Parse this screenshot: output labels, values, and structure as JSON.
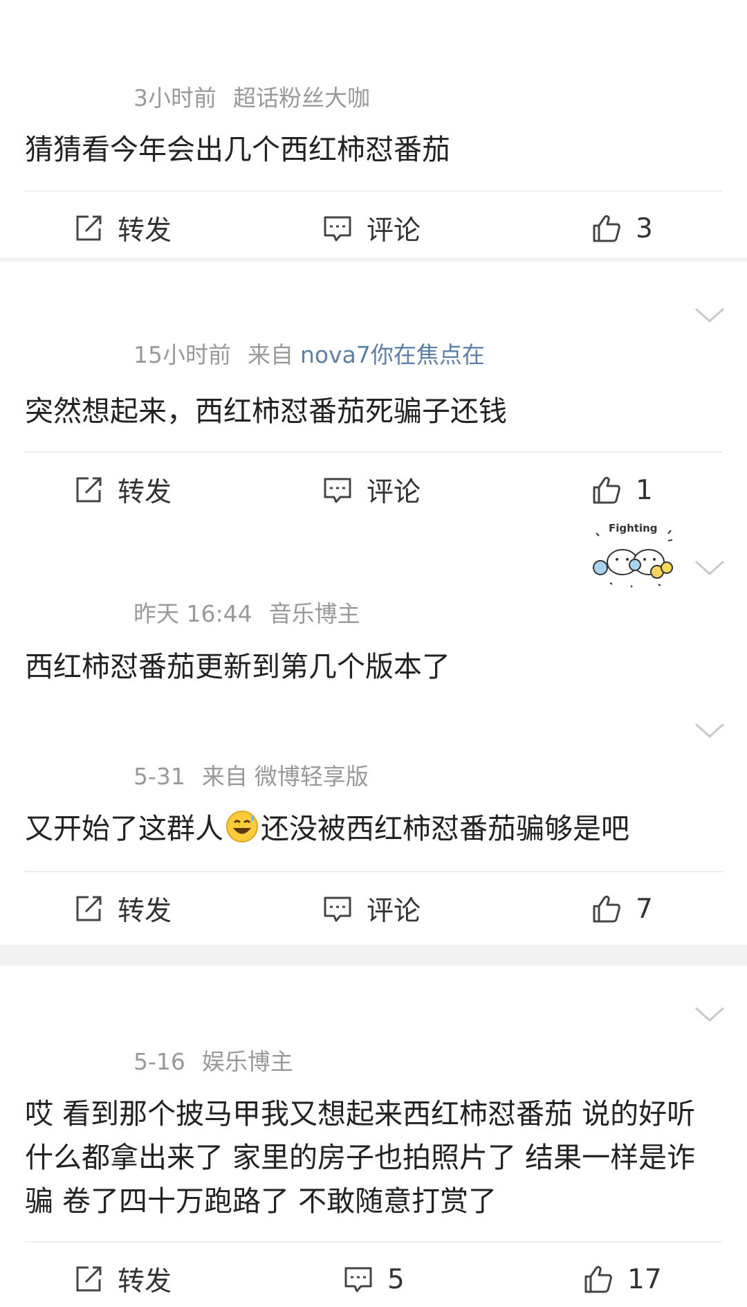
{
  "labels": {
    "repost": "转发",
    "comment": "评论"
  },
  "posts": [
    {
      "time": "3小时前",
      "source_prefix": "",
      "source": "超话粉丝大咖",
      "content": "猜猜看今年会出几个西红柿怼番茄",
      "comment_count": "",
      "like_count": "3"
    },
    {
      "time": "15小时前",
      "source_prefix": "来自",
      "source": "nova7你在焦点在",
      "content": "突然想起来，西红柿怼番茄死骗子还钱",
      "comment_count": "",
      "like_count": "1"
    },
    {
      "time": "昨天 16:44",
      "source_prefix": "",
      "source": "音乐博主",
      "content": "西红柿怼番茄更新到第几个版本了",
      "sticker_text": "Fighting"
    },
    {
      "time": "5-31",
      "source_prefix": "来自",
      "source": "微博轻享版",
      "content_a": "又开始了这群人",
      "content_b": "还没被西红柿怼番茄骗够是吧",
      "emoji": "sweat-smile-emoji",
      "comment_count": "",
      "like_count": "7"
    },
    {
      "time": "5-16",
      "source_prefix": "",
      "source": "娱乐博主",
      "content": "哎 看到那个披马甲我又想起来西红柿怼番茄 说的好听 什么都拿出来了 家里的房子也拍照片了 结果一样是诈骗 卷了四十万跑路了 不敢随意打赏了",
      "comment_count": "5",
      "like_count": "17"
    }
  ],
  "colors": {
    "meta": "#999999",
    "source_link": "#5b7fa8",
    "text": "#222222",
    "separator": "#f2f2f2"
  }
}
